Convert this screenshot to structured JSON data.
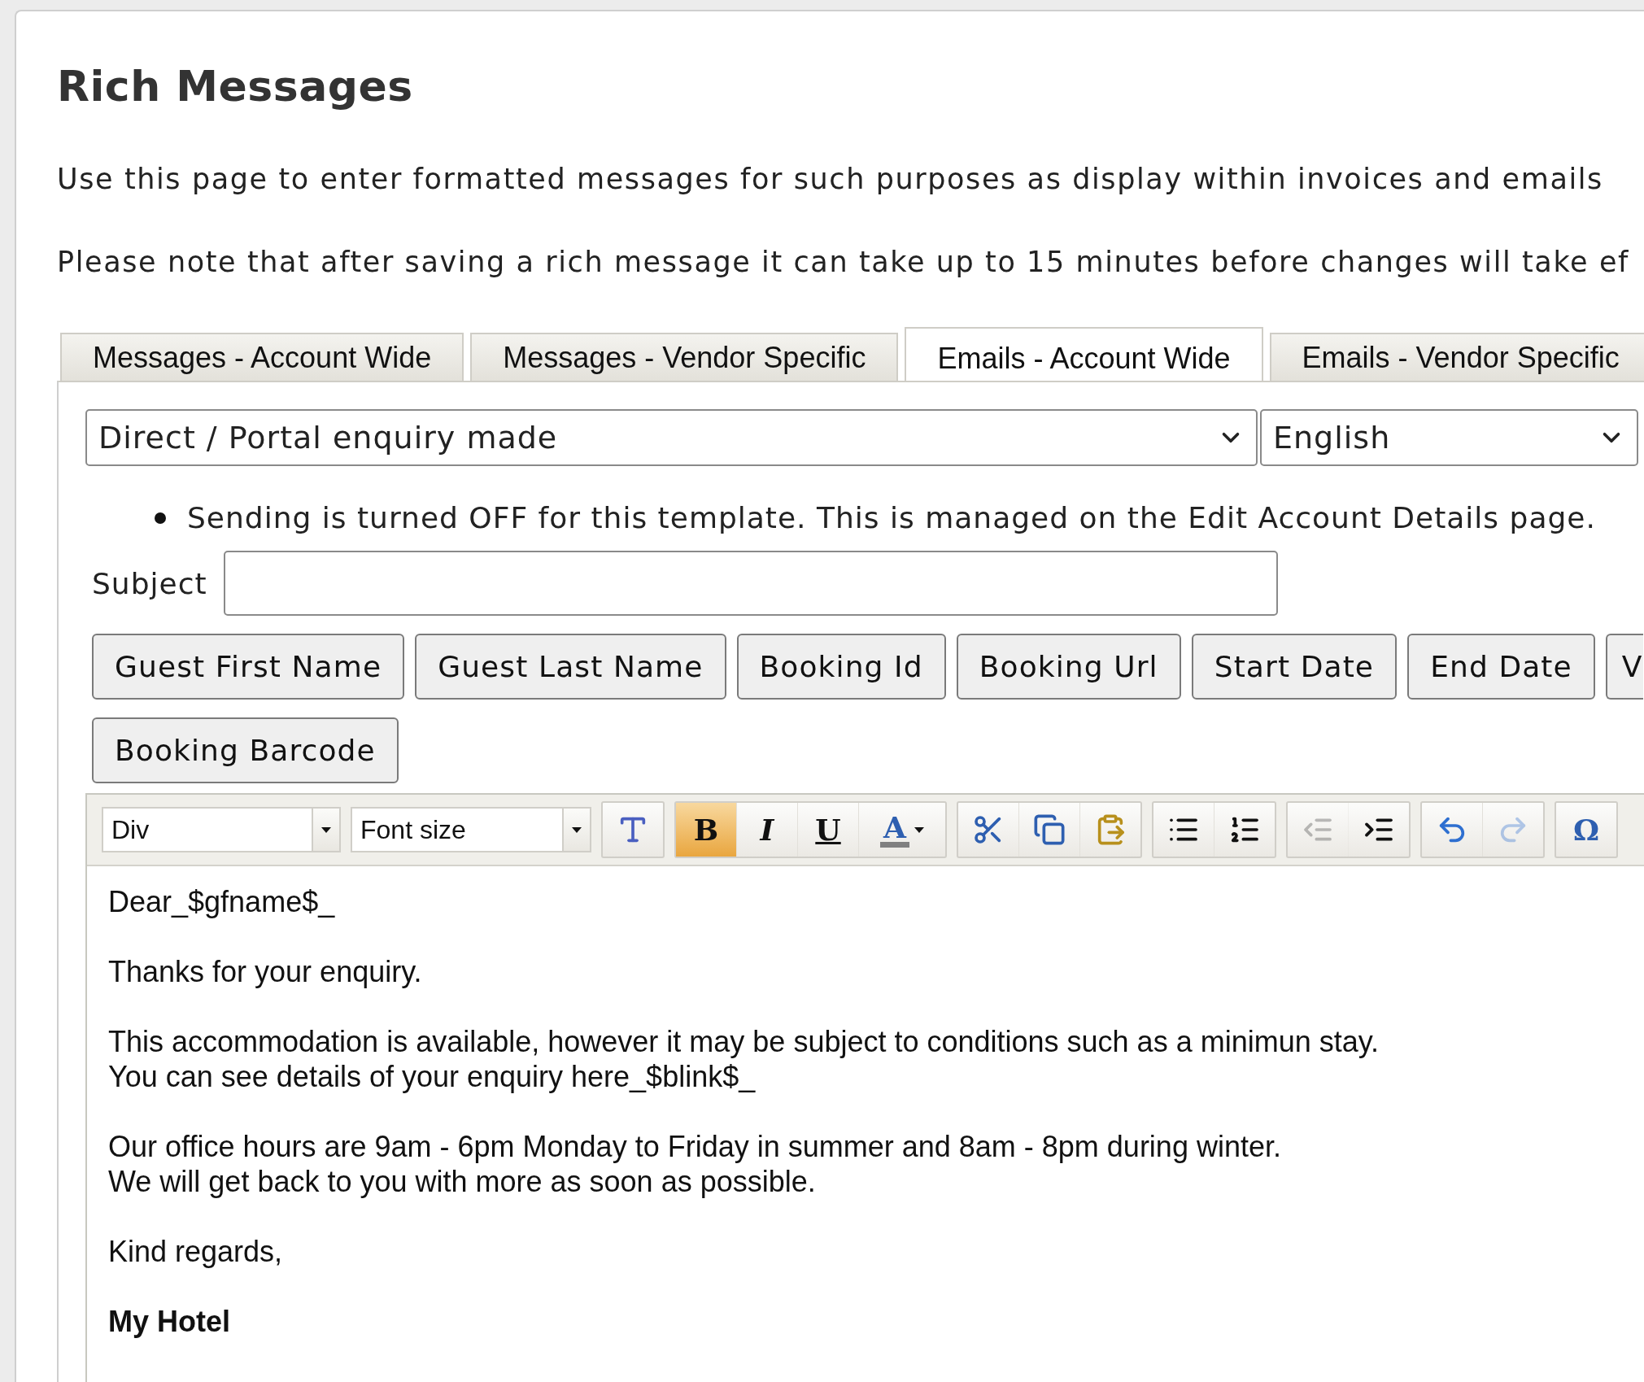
{
  "page": {
    "title": "Rich Messages",
    "intro": [
      "Use this page to enter formatted messages for such purposes as display within invoices and emails",
      "Please note that after saving a rich message it can take up to 15 minutes before changes will take ef"
    ]
  },
  "tabs": [
    {
      "label": "Messages - Account Wide",
      "selected": false
    },
    {
      "label": "Messages - Vendor Specific",
      "selected": false
    },
    {
      "label": "Emails - Account Wide",
      "selected": true
    },
    {
      "label": "Emails - Vendor Specific",
      "selected": false
    }
  ],
  "template_select": {
    "value": "Direct / Portal enquiry made"
  },
  "language_select": {
    "value": "English"
  },
  "notices": [
    "Sending is turned OFF for this template. This is managed on the Edit Account Details page."
  ],
  "subject": {
    "label": "Subject"
  },
  "placeholder_rows": [
    [
      "Guest First Name",
      "Guest Last Name",
      "Booking Id",
      "Booking Url",
      "Start Date",
      "End Date",
      "V"
    ],
    [
      "Booking Barcode"
    ]
  ],
  "editor": {
    "toolbar": {
      "format_combo": {
        "value": "Div"
      },
      "size_combo": {
        "placeholder": "Font size"
      },
      "groups": [
        {
          "items": [
            {
              "kind": "styles",
              "active": false,
              "disabled": false
            }
          ]
        },
        {
          "items": [
            {
              "kind": "bold",
              "glyph": "B",
              "active": true,
              "disabled": false
            },
            {
              "kind": "italic",
              "glyph": "I",
              "active": false,
              "disabled": false
            },
            {
              "kind": "underline",
              "glyph": "U",
              "active": false,
              "disabled": false
            },
            {
              "kind": "text-color",
              "glyph": "A",
              "active": false,
              "disabled": false
            }
          ]
        },
        {
          "items": [
            {
              "kind": "cut",
              "active": false,
              "disabled": false
            },
            {
              "kind": "copy",
              "active": false,
              "disabled": false
            },
            {
              "kind": "paste",
              "active": false,
              "disabled": false
            }
          ]
        },
        {
          "items": [
            {
              "kind": "bulleted-list",
              "active": false,
              "disabled": false
            },
            {
              "kind": "numbered-list",
              "active": false,
              "disabled": false
            }
          ]
        },
        {
          "items": [
            {
              "kind": "outdent",
              "active": false,
              "disabled": true
            },
            {
              "kind": "indent",
              "active": false,
              "disabled": false
            }
          ]
        },
        {
          "items": [
            {
              "kind": "undo",
              "active": false,
              "disabled": false
            },
            {
              "kind": "redo",
              "active": false,
              "disabled": true
            }
          ]
        },
        {
          "items": [
            {
              "kind": "special-character",
              "glyph": "Ω",
              "active": false,
              "disabled": false
            }
          ]
        }
      ]
    },
    "paragraphs": [
      {
        "lines": [
          "Dear_$gfname$_"
        ],
        "bold": false
      },
      {
        "lines": [
          "Thanks for your enquiry."
        ],
        "bold": false
      },
      {
        "lines": [
          "This accommodation is available, however it may be subject to conditions such as a minimun stay.",
          "You can see details of your enquiry here_$blink$_"
        ],
        "bold": false
      },
      {
        "lines": [
          "Our office hours are 9am - 6pm Monday to Friday in summer and 8am - 8pm during winter.",
          "We will get back to you with more as soon as possible."
        ],
        "bold": false
      },
      {
        "lines": [
          "Kind regards,"
        ],
        "bold": false
      },
      {
        "lines": [
          "My Hotel"
        ],
        "bold": true
      }
    ]
  }
}
